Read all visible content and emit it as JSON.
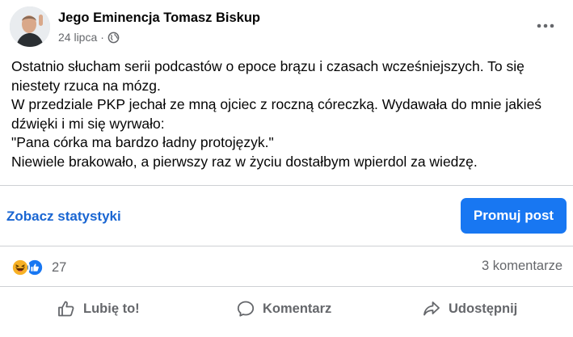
{
  "post": {
    "author": "Jego Eminencja Tomasz Biskup",
    "date": "24 lipca",
    "separator": "·",
    "privacy_icon": "globe-icon",
    "more_icon": "ellipsis-icon",
    "text_lines": [
      "Ostatnio słucham serii podcastów o epoce brązu i czasach wcześniejszych. To się",
      "niestety rzuca na mózg.",
      "W przedziale PKP jechał ze mną ojciec z roczną córeczką. Wydawała do mnie jakieś",
      "dźwięki i mi się wyrwało:",
      "\"Pana córka ma bardzo ładny protojęzyk.\"",
      "Niewiele brakowało, a pierwszy raz w życiu dostałbym wpierdol za wiedzę."
    ]
  },
  "insights": {
    "stats_link": "Zobacz statystyki",
    "promote_button": "Promuj post"
  },
  "engagement": {
    "reaction_icons": [
      "haha-icon",
      "like-icon"
    ],
    "reactions_count": "27",
    "comments_count": "3 komentarze"
  },
  "actions": {
    "like": "Lubię to!",
    "comment": "Komentarz",
    "share": "Udostępnij"
  },
  "colors": {
    "accent": "#1877f2",
    "link": "#1a66d2",
    "secondary_text": "#65676b",
    "divider": "#ced0d4",
    "haha": "#f7b125",
    "like": "#1877f2"
  }
}
